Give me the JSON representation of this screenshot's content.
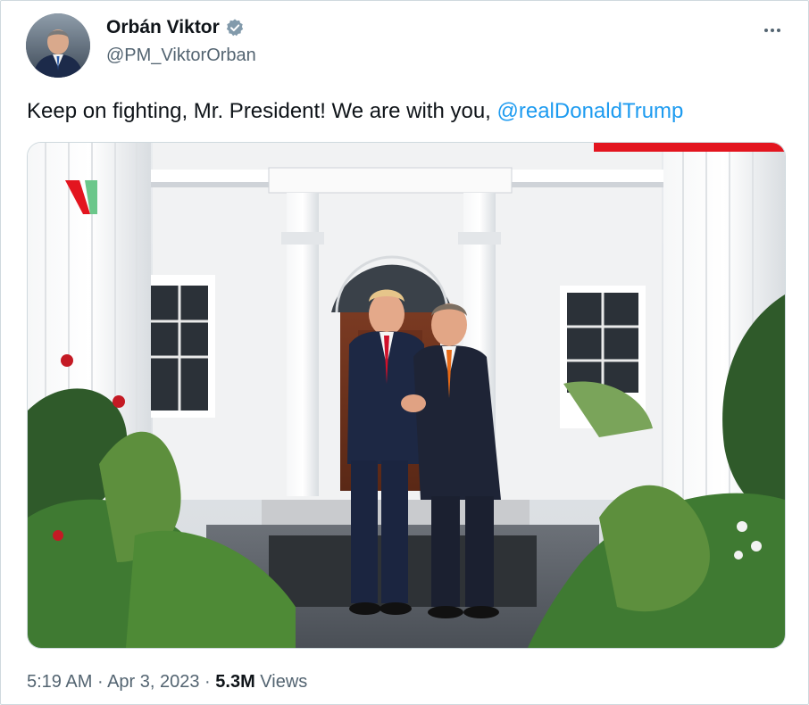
{
  "author": {
    "name": "Orbán Viktor",
    "handle": "@PM_ViktorOrban",
    "verified": true,
    "avatar_icon": "avatar-portrait"
  },
  "tweet": {
    "text": "Keep on fighting, Mr. President! We are with you, ",
    "mention": "@realDonaldTrump"
  },
  "media": {
    "icon": "photo-two-men-handshake-white-house-entrance"
  },
  "meta": {
    "time": "5:19 AM",
    "separator": " · ",
    "date": "Apr 3, 2023",
    "views_count": "5.3M",
    "views_label": " Views"
  },
  "colors": {
    "link": "#1d9bf0",
    "verified_badge": "#829aab",
    "secondary_text": "#536471",
    "border": "#cfd9de",
    "flag_red": "#e3151f",
    "flag_green": "#6bc78a"
  }
}
